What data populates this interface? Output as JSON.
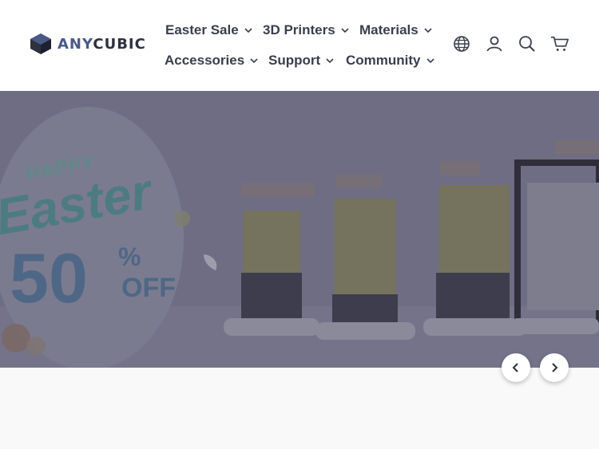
{
  "brand": {
    "name_part1": "ANY",
    "name_part2": "CUBIC"
  },
  "nav": {
    "items": [
      {
        "label": "Easter Sale"
      },
      {
        "label": "3D Printers"
      },
      {
        "label": "Materials"
      },
      {
        "label": "Accessories"
      },
      {
        "label": "Support"
      },
      {
        "label": "Community"
      }
    ]
  },
  "header_icons": [
    "globe-icon",
    "account-icon",
    "search-icon",
    "cart-icon"
  ],
  "hero": {
    "happy": "HAPPY",
    "easter": "Easter",
    "discount": "50",
    "percent": "%",
    "off": "OFF"
  },
  "colors": {
    "hero_overlay": "#6f6e84",
    "brand_blue": "#4a5a86",
    "text": "#2a2f3a"
  }
}
